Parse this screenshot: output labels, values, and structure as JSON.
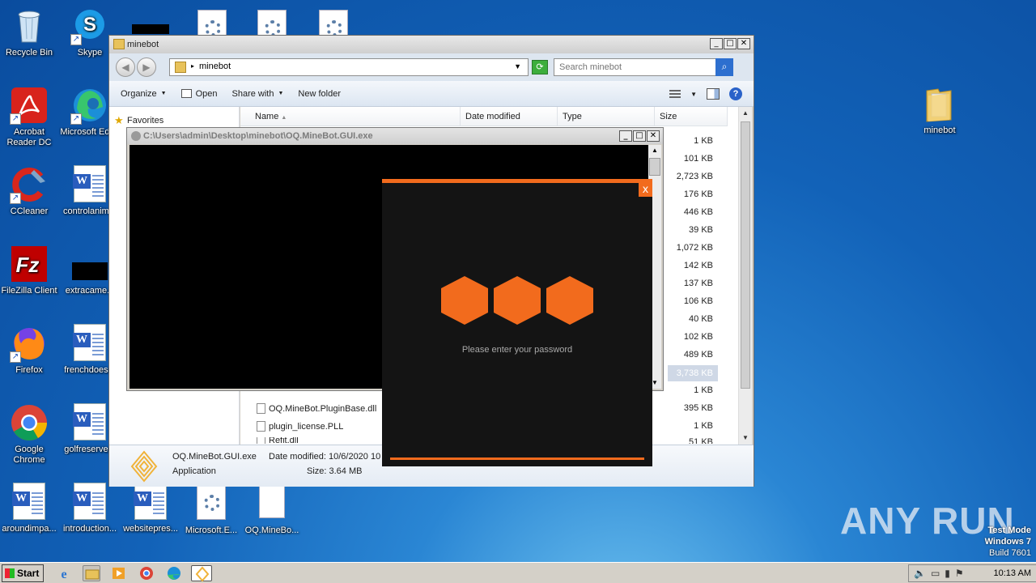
{
  "desktop": {
    "icons": [
      {
        "label": "Recycle Bin"
      },
      {
        "label": "Skype"
      },
      {
        "label": "Acrobat Reader DC"
      },
      {
        "label": "Microsoft Edge"
      },
      {
        "label": "CCleaner"
      },
      {
        "label": "controlanim..."
      },
      {
        "label": "FileZilla Client"
      },
      {
        "label": "extracame..."
      },
      {
        "label": "Firefox"
      },
      {
        "label": "frenchdoes..."
      },
      {
        "label": "Google Chrome"
      },
      {
        "label": "golfreserve..."
      },
      {
        "label": "aroundimpa..."
      },
      {
        "label": "introduction..."
      },
      {
        "label": "websitepres..."
      },
      {
        "label": "Microsoft.E..."
      },
      {
        "label": "OQ.MineBo..."
      },
      {
        "label": "minebot"
      }
    ]
  },
  "explorer": {
    "title": "minebot",
    "address": "minebot",
    "search_placeholder": "Search minebot",
    "toolbar": {
      "organize": "Organize",
      "open": "Open",
      "share_with": "Share with",
      "new_folder": "New folder"
    },
    "favorites": "Favorites",
    "columns": {
      "name": "Name",
      "date_modified": "Date modified",
      "type": "Type",
      "size": "Size"
    },
    "sizes": [
      "1 KB",
      "101 KB",
      "2,723 KB",
      "176 KB",
      "446 KB",
      "39 KB",
      "1,072 KB",
      "142 KB",
      "137 KB",
      "106 KB",
      "40 KB",
      "102 KB",
      "489 KB",
      "3,738 KB",
      "1 KB",
      "395 KB",
      "1 KB",
      "51 KB"
    ],
    "visible_files": [
      {
        "name": "OQ.MineBot.PluginBase.dll"
      },
      {
        "name": "plugin_license.PLL"
      },
      {
        "name": "Refit.dll"
      }
    ],
    "details": {
      "name": "OQ.MineBot.GUI.exe",
      "type": "Application",
      "date_modified": "Date modified: 10/6/2020 10",
      "size": "Size: 3.64 MB"
    }
  },
  "console": {
    "title": "C:\\Users\\admin\\Desktop\\minebot\\OQ.MineBot.GUI.exe"
  },
  "dialog": {
    "close": "x",
    "prompt": "Please enter your password",
    "colors": {
      "accent": "#f26b1d",
      "background": "#141414"
    }
  },
  "taskbar": {
    "start": "Start",
    "clock": "10:13 AM"
  },
  "watermark": {
    "text": "ANY RUN",
    "test_mode": "Test Mode",
    "os": "Windows 7",
    "build": "Build 7601"
  }
}
